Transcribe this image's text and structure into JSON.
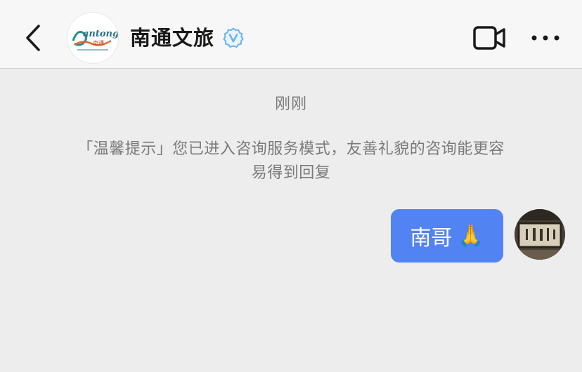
{
  "header": {
    "title": "南通文旅",
    "back_icon": "chevron-left-icon",
    "verified_icon": "verified-badge-icon",
    "video_icon": "video-camera-icon",
    "more_icon": "more-dots-icon",
    "logo_text": "Nantong",
    "verified_color": "#6ab0f3"
  },
  "chat": {
    "timestamp": "刚刚",
    "notice": "「温馨提示」您已进入咨询服务模式，友善礼貌的咨询能更容易得到回复",
    "message": {
      "text": "南哥",
      "emoji": "🙏",
      "bubble_color": "#5283f2"
    }
  }
}
